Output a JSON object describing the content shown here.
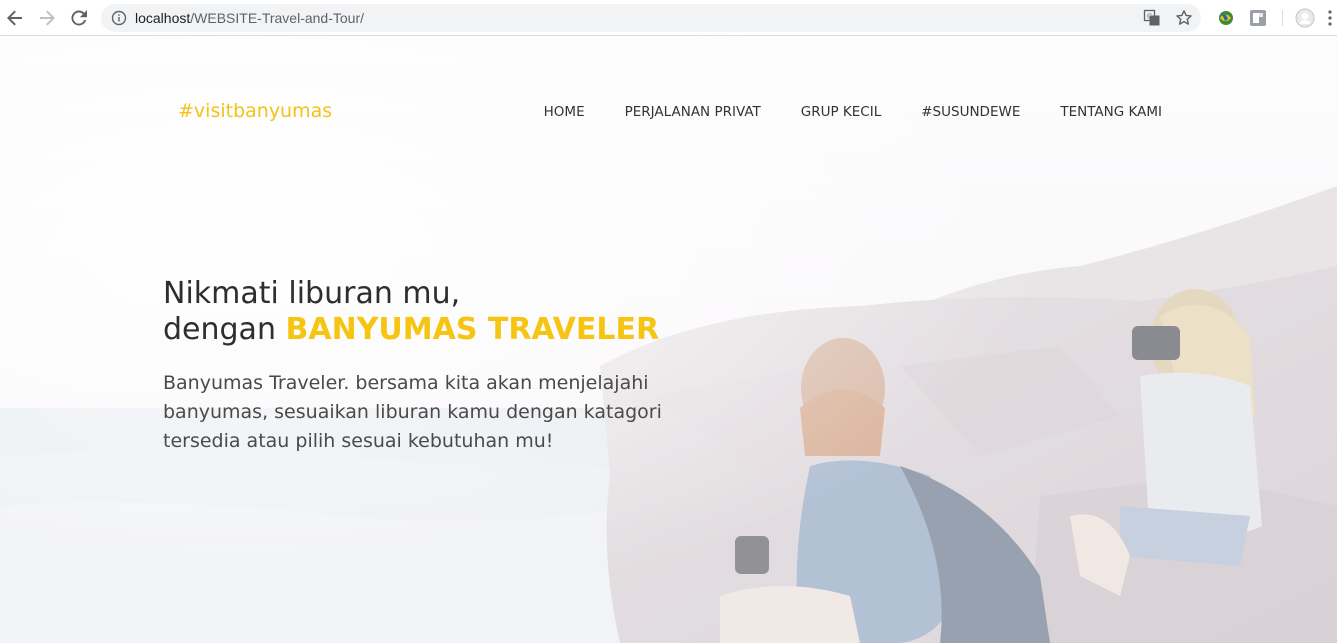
{
  "browser": {
    "url_host": "localhost",
    "url_path": "/WEBSITE-Travel-and-Tour/",
    "icons": {
      "back": "back-arrow-icon",
      "forward": "forward-arrow-icon",
      "reload": "reload-icon",
      "info": "info-icon",
      "translate": "translate-icon",
      "bookmark": "star-icon",
      "extension1": "extension-globe-icon",
      "extension2": "extension-gray-icon",
      "profile": "profile-avatar-icon",
      "menu": "kebab-menu-icon"
    }
  },
  "site": {
    "brand": "#visitbanyumas",
    "nav": [
      "HOME",
      "PERJALANAN PRIVAT",
      "GRUP KECIL",
      "#SUSUNDEWE",
      "TENTANG KAMI"
    ],
    "headline_line1": "Nikmati liburan mu,",
    "headline_line2_prefix": "dengan ",
    "headline_line2_accent": "BANYUMAS TRAVELER",
    "lead": "Banyumas Traveler. bersama kita akan menjelajahi banyumas, sesuaikan liburan kamu dengan katagori tersedia atau pilih sesuai kebutuhan mu!"
  },
  "colors": {
    "accent": "#f6c412",
    "nav_text": "#333333",
    "headline_text": "#2e2e2e"
  }
}
